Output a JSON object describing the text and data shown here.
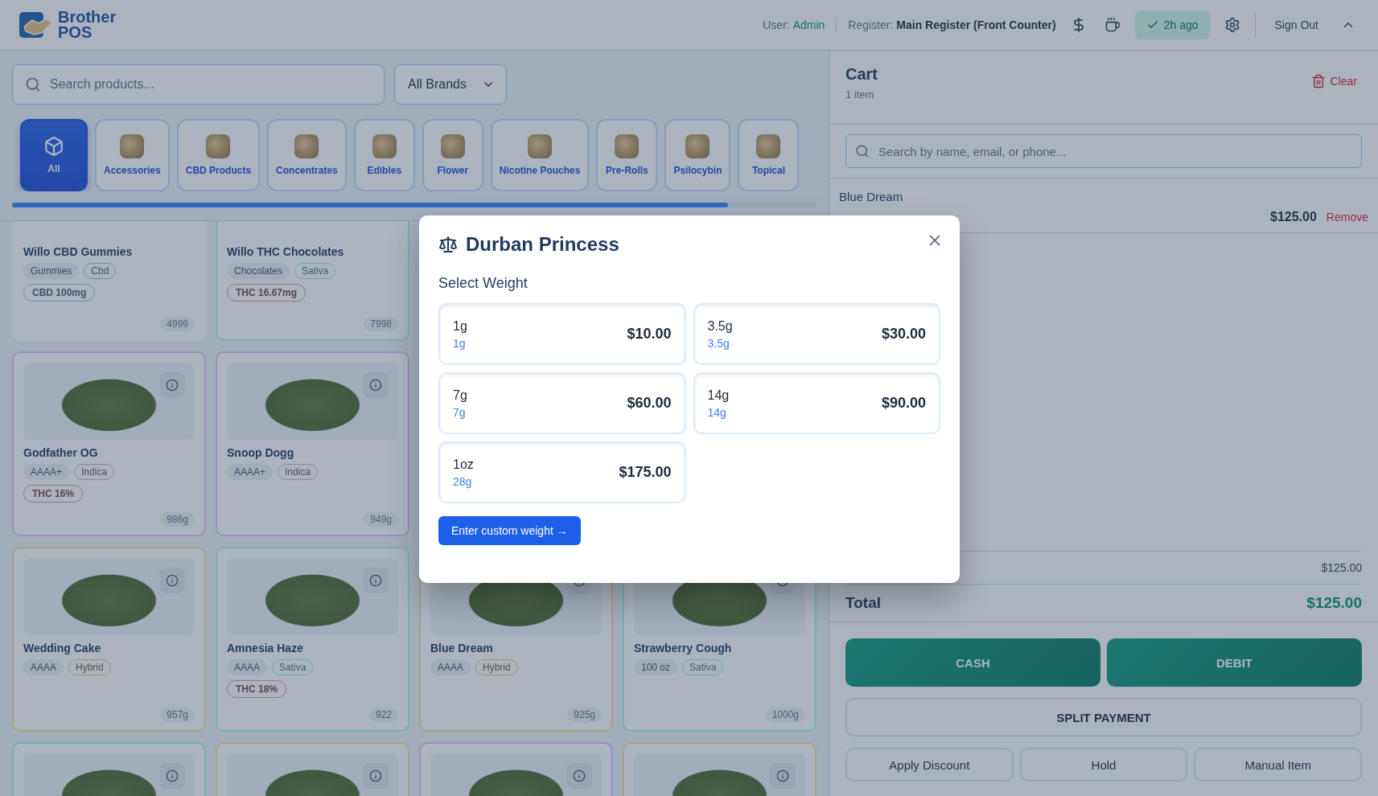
{
  "header": {
    "logo": {
      "line_1": "Brother",
      "line_2": "POS"
    },
    "user_label": "User:",
    "user": "Admin",
    "register_label": "Register:",
    "register": "Main Register (Front Counter)",
    "sync_status": "2h ago",
    "sign_out": "Sign Out"
  },
  "search": {
    "placeholder": "Search products..."
  },
  "brand_filter": {
    "value": "All Brands"
  },
  "categories": [
    {
      "label": "All",
      "selected": true,
      "kind": "icon"
    },
    {
      "label": "Accessories",
      "selected": false,
      "kind": "photo"
    },
    {
      "label": "CBD Products",
      "selected": false,
      "kind": "photo"
    },
    {
      "label": "Concentrates",
      "selected": false,
      "kind": "photo"
    },
    {
      "label": "Edibles",
      "selected": false,
      "kind": "photo"
    },
    {
      "label": "Flower",
      "selected": false,
      "kind": "photo"
    },
    {
      "label": "Nicotine Pouches",
      "selected": false,
      "kind": "photo"
    },
    {
      "label": "Pre-Rolls",
      "selected": false,
      "kind": "photo"
    },
    {
      "label": "Psilocybin",
      "selected": false,
      "kind": "photo"
    },
    {
      "label": "Topical",
      "selected": false,
      "kind": "photo"
    }
  ],
  "products": {
    "rows": [
      {
        "items": [
          {
            "name": "Willo CBD Gummies",
            "color": "#a9b3bd",
            "image": false,
            "tags": [
              {
                "label": "Gummies",
                "kind": "grade"
              },
              {
                "label": "Cbd",
                "kind": "strain",
                "color": "#6890bd"
              }
            ],
            "potency": {
              "label": "CBD 100mg",
              "color": "#6890bd"
            },
            "stock": "4999"
          },
          {
            "name": "Willo THC Chocolates",
            "color": "#70c0aa",
            "image": false,
            "tags": [
              {
                "label": "Chocolates",
                "kind": "grade"
              },
              {
                "label": "Sativa",
                "kind": "strain",
                "color": "#5fb497"
              }
            ],
            "potency": {
              "label": "THC 16.67mg",
              "color": "#a87070"
            },
            "stock": "7998"
          }
        ]
      },
      {
        "items": [
          {
            "name": "Godfather OG",
            "color": "#a08cbe",
            "image": true,
            "tags": [
              {
                "label": "AAAA+",
                "kind": "grade"
              },
              {
                "label": "Indica",
                "kind": "strain",
                "color": "#9a80bc"
              }
            ],
            "potency": {
              "label": "THC 16%",
              "color": "#a87070"
            },
            "stock": "986g"
          },
          {
            "name": "Snoop Dogg",
            "color": "#a08cbe",
            "image": true,
            "tags": [
              {
                "label": "AAAA+",
                "kind": "grade"
              },
              {
                "label": "Indica",
                "kind": "strain",
                "color": "#9a80bc"
              }
            ],
            "stock": "949g"
          }
        ]
      },
      {
        "items": [
          {
            "name": "Wedding Cake",
            "color": "#aaa080",
            "image": true,
            "tags": [
              {
                "label": "AAAA",
                "kind": "grade"
              },
              {
                "label": "Hybrid",
                "kind": "strain",
                "color": "#a8905c"
              }
            ],
            "stock": "957g"
          },
          {
            "name": "Amnesia Haze",
            "color": "#70c0aa",
            "image": true,
            "tags": [
              {
                "label": "AAAA",
                "kind": "grade"
              },
              {
                "label": "Sativa",
                "kind": "strain",
                "color": "#5fb497"
              }
            ],
            "potency": {
              "label": "THC 18%",
              "color": "#a87070"
            },
            "stock": "922"
          },
          {
            "name": "Blue Dream",
            "color": "#aaa080",
            "image": true,
            "tags": [
              {
                "label": "AAAA",
                "kind": "grade"
              },
              {
                "label": "Hybrid",
                "kind": "strain",
                "color": "#a8905c"
              }
            ],
            "stock": "925g"
          },
          {
            "name": "Strawberry Cough",
            "color": "#70c0aa",
            "image": true,
            "tags": [
              {
                "label": "100 oz",
                "kind": "grade"
              },
              {
                "label": "Sativa",
                "kind": "strain",
                "color": "#5fb497"
              }
            ],
            "stock": "1000g"
          }
        ]
      },
      {
        "items": [
          {
            "color": "#70c0aa",
            "image": true
          },
          {
            "color": "#aaa080",
            "image": true
          },
          {
            "color": "#a08cbe",
            "image": true
          },
          {
            "color": "#aaa080",
            "image": true
          }
        ]
      }
    ]
  },
  "modal": {
    "title": "Durban Princess",
    "subtitle": "Select Weight",
    "options": [
      {
        "label": "1g",
        "sub": "1g",
        "price": "$10.00"
      },
      {
        "label": "3.5g",
        "sub": "3.5g",
        "price": "$30.00"
      },
      {
        "label": "7g",
        "sub": "7g",
        "price": "$60.00"
      },
      {
        "label": "14g",
        "sub": "14g",
        "price": "$90.00"
      },
      {
        "label": "1oz",
        "sub": "28g",
        "price": "$175.00"
      }
    ],
    "custom_button": "Enter custom weight →"
  },
  "cart": {
    "title": "Cart",
    "count": "1 item",
    "clear": "Clear",
    "customer_search": {
      "placeholder": "Search by name, email, or phone..."
    },
    "items": [
      {
        "name": "Blue Dream",
        "price": "$125.00",
        "remove": "Remove"
      }
    ],
    "subtotal_value": "$125.00",
    "total_label": "Total",
    "total_value": "$125.00",
    "payments": [
      {
        "label": "CASH"
      },
      {
        "label": "DEBIT"
      }
    ],
    "split": "SPLIT PAYMENT",
    "actions": [
      {
        "label": "Apply Discount"
      },
      {
        "label": "Hold"
      },
      {
        "label": "Manual Item"
      }
    ]
  }
}
